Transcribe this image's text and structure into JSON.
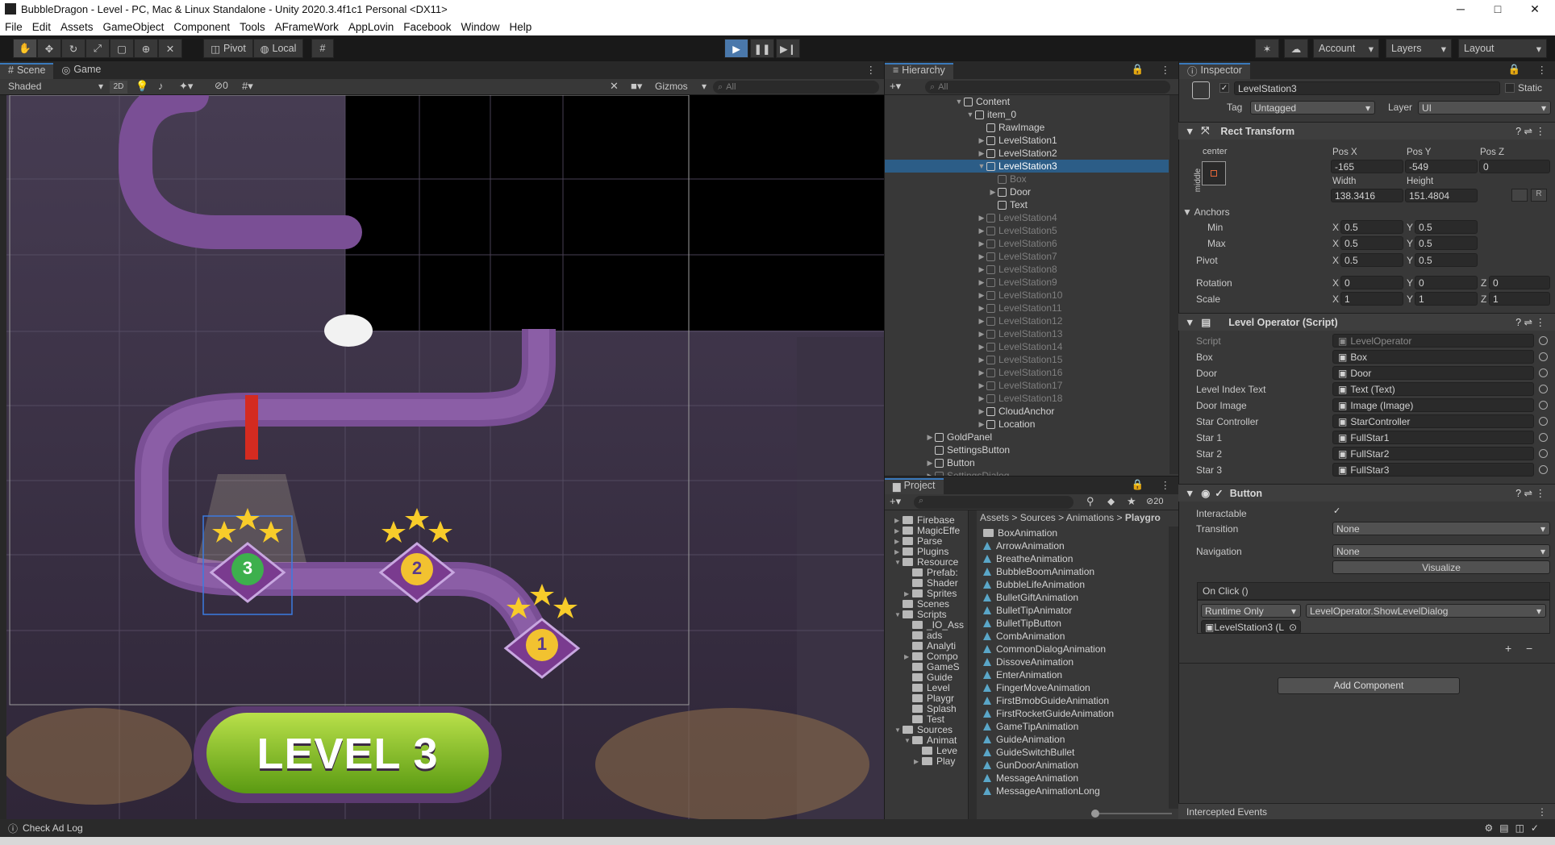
{
  "window": {
    "title": "BubbleDragon - Level - PC, Mac & Linux Standalone - Unity 2020.3.4f1c1 Personal <DX11>",
    "minimize": "─",
    "maximize": "□",
    "close": "✕"
  },
  "menu": [
    "File",
    "Edit",
    "Assets",
    "GameObject",
    "Component",
    "Tools",
    "AFrameWork",
    "AppLovin",
    "Facebook",
    "Window",
    "Help"
  ],
  "toolbar": {
    "pivot": "Pivot",
    "local": "Local",
    "account": "Account",
    "layers": "Layers",
    "layout": "Layout"
  },
  "scene": {
    "tab_scene": "Scene",
    "tab_game": "Game",
    "shading": "Shaded",
    "mode_2d": "2D",
    "hidden_count": "0",
    "gizmos": "Gizmos",
    "search_placeholder": "All",
    "level_button": "LEVEL 3",
    "station_numbers": [
      "3",
      "2",
      "1"
    ]
  },
  "hierarchy": {
    "tab": "Hierarchy",
    "search_placeholder": "All",
    "rows": [
      {
        "label": "Content",
        "indent": 0,
        "arrow": "▼",
        "dim": false,
        "sel": false
      },
      {
        "label": "item_0",
        "indent": 1,
        "arrow": "▼",
        "dim": false,
        "sel": false
      },
      {
        "label": "RawImage",
        "indent": 2,
        "arrow": "",
        "dim": false,
        "sel": false
      },
      {
        "label": "LevelStation1",
        "indent": 2,
        "arrow": "▶",
        "dim": false,
        "sel": false
      },
      {
        "label": "LevelStation2",
        "indent": 2,
        "arrow": "▶",
        "dim": false,
        "sel": false
      },
      {
        "label": "LevelStation3",
        "indent": 2,
        "arrow": "▼",
        "dim": false,
        "sel": true
      },
      {
        "label": "Box",
        "indent": 3,
        "arrow": "",
        "dim": true,
        "sel": false
      },
      {
        "label": "Door",
        "indent": 3,
        "arrow": "▶",
        "dim": false,
        "sel": false
      },
      {
        "label": "Text",
        "indent": 3,
        "arrow": "",
        "dim": false,
        "sel": false
      },
      {
        "label": "LevelStation4",
        "indent": 2,
        "arrow": "▶",
        "dim": true,
        "sel": false
      },
      {
        "label": "LevelStation5",
        "indent": 2,
        "arrow": "▶",
        "dim": true,
        "sel": false
      },
      {
        "label": "LevelStation6",
        "indent": 2,
        "arrow": "▶",
        "dim": true,
        "sel": false
      },
      {
        "label": "LevelStation7",
        "indent": 2,
        "arrow": "▶",
        "dim": true,
        "sel": false
      },
      {
        "label": "LevelStation8",
        "indent": 2,
        "arrow": "▶",
        "dim": true,
        "sel": false
      },
      {
        "label": "LevelStation9",
        "indent": 2,
        "arrow": "▶",
        "dim": true,
        "sel": false
      },
      {
        "label": "LevelStation10",
        "indent": 2,
        "arrow": "▶",
        "dim": true,
        "sel": false
      },
      {
        "label": "LevelStation11",
        "indent": 2,
        "arrow": "▶",
        "dim": true,
        "sel": false
      },
      {
        "label": "LevelStation12",
        "indent": 2,
        "arrow": "▶",
        "dim": true,
        "sel": false
      },
      {
        "label": "LevelStation13",
        "indent": 2,
        "arrow": "▶",
        "dim": true,
        "sel": false
      },
      {
        "label": "LevelStation14",
        "indent": 2,
        "arrow": "▶",
        "dim": true,
        "sel": false
      },
      {
        "label": "LevelStation15",
        "indent": 2,
        "arrow": "▶",
        "dim": true,
        "sel": false
      },
      {
        "label": "LevelStation16",
        "indent": 2,
        "arrow": "▶",
        "dim": true,
        "sel": false
      },
      {
        "label": "LevelStation17",
        "indent": 2,
        "arrow": "▶",
        "dim": true,
        "sel": false
      },
      {
        "label": "LevelStation18",
        "indent": 2,
        "arrow": "▶",
        "dim": true,
        "sel": false
      },
      {
        "label": "CloudAnchor",
        "indent": 2,
        "arrow": "▶",
        "dim": false,
        "sel": false
      },
      {
        "label": "Location",
        "indent": 2,
        "arrow": "▶",
        "dim": false,
        "sel": false
      },
      {
        "label": "GoldPanel",
        "indent": -1,
        "arrow": "▶",
        "dim": false,
        "sel": false
      },
      {
        "label": "SettingsButton",
        "indent": -1,
        "arrow": "",
        "dim": false,
        "sel": false
      },
      {
        "label": "Button",
        "indent": -1,
        "arrow": "▶",
        "dim": false,
        "sel": false
      },
      {
        "label": "SettingsDialog",
        "indent": -1,
        "arrow": "▶",
        "dim": true,
        "sel": false
      }
    ]
  },
  "project": {
    "tab": "Project",
    "count": "20",
    "breadcrumb": [
      "Assets",
      "Sources",
      "Animations",
      "Playgro"
    ],
    "tree": [
      {
        "label": "Firebase",
        "indent": 0,
        "arrow": "▶"
      },
      {
        "label": "MagicEffe",
        "indent": 0,
        "arrow": "▶"
      },
      {
        "label": "Parse",
        "indent": 0,
        "arrow": "▶"
      },
      {
        "label": "Plugins",
        "indent": 0,
        "arrow": "▶"
      },
      {
        "label": "Resource",
        "indent": 0,
        "arrow": "▼"
      },
      {
        "label": "Prefab:",
        "indent": 1,
        "arrow": ""
      },
      {
        "label": "Shader",
        "indent": 1,
        "arrow": ""
      },
      {
        "label": "Sprites",
        "indent": 1,
        "arrow": "▶"
      },
      {
        "label": "Scenes",
        "indent": 0,
        "arrow": ""
      },
      {
        "label": "Scripts",
        "indent": 0,
        "arrow": "▼"
      },
      {
        "label": "_IO_Ass",
        "indent": 1,
        "arrow": ""
      },
      {
        "label": "ads",
        "indent": 1,
        "arrow": ""
      },
      {
        "label": "Analyti",
        "indent": 1,
        "arrow": ""
      },
      {
        "label": "Compo",
        "indent": 1,
        "arrow": "▶"
      },
      {
        "label": "GameS",
        "indent": 1,
        "arrow": ""
      },
      {
        "label": "Guide",
        "indent": 1,
        "arrow": ""
      },
      {
        "label": "Level",
        "indent": 1,
        "arrow": ""
      },
      {
        "label": "Playgr",
        "indent": 1,
        "arrow": ""
      },
      {
        "label": "Splash",
        "indent": 1,
        "arrow": ""
      },
      {
        "label": "Test",
        "indent": 1,
        "arrow": ""
      },
      {
        "label": "Sources",
        "indent": 0,
        "arrow": "▼"
      },
      {
        "label": "Animat",
        "indent": 1,
        "arrow": "▼"
      },
      {
        "label": "Leve",
        "indent": 2,
        "arrow": ""
      },
      {
        "label": "Play",
        "indent": 2,
        "arrow": "▶"
      }
    ],
    "files": [
      {
        "label": "BoxAnimation",
        "folder": true
      },
      {
        "label": "ArrowAnimation",
        "folder": false
      },
      {
        "label": "BreatheAnimation",
        "folder": false
      },
      {
        "label": "BubbleBoomAnimation",
        "folder": false
      },
      {
        "label": "BubbleLifeAnimation",
        "folder": false
      },
      {
        "label": "BulletGiftAnimation",
        "folder": false
      },
      {
        "label": "BulletTipAnimator",
        "folder": false
      },
      {
        "label": "BulletTipButton",
        "folder": false
      },
      {
        "label": "CombAnimation",
        "folder": false
      },
      {
        "label": "CommonDialogAnimation",
        "folder": false
      },
      {
        "label": "DissoveAnimation",
        "folder": false
      },
      {
        "label": "EnterAnimation",
        "folder": false
      },
      {
        "label": "FingerMoveAnimation",
        "folder": false
      },
      {
        "label": "FirstBmobGuideAnimation",
        "folder": false
      },
      {
        "label": "FirstRocketGuideAnimation",
        "folder": false
      },
      {
        "label": "GameTipAnimation",
        "folder": false
      },
      {
        "label": "GuideAnimation",
        "folder": false
      },
      {
        "label": "GuideSwitchBullet",
        "folder": false
      },
      {
        "label": "GunDoorAnimation",
        "folder": false
      },
      {
        "label": "MessageAnimation",
        "folder": false
      },
      {
        "label": "MessageAnimationLong",
        "folder": false
      }
    ]
  },
  "inspector": {
    "tab": "Inspector",
    "object_name": "LevelStation3",
    "static": "Static",
    "tag_label": "Tag",
    "tag_value": "Untagged",
    "layer_label": "Layer",
    "layer_value": "UI",
    "rect": {
      "title": "Rect Transform",
      "anchor_preset_h": "center",
      "anchor_preset_v": "middle",
      "posx_label": "Pos X",
      "posy_label": "Pos Y",
      "posz_label": "Pos Z",
      "posx": "-165",
      "posy": "-549",
      "posz": "0",
      "width_label": "Width",
      "height_label": "Height",
      "width": "138.3416",
      "height": "151.4804",
      "r_button": "R",
      "anchors": "Anchors",
      "min": "Min",
      "max": "Max",
      "min_x": "0.5",
      "min_y": "0.5",
      "max_x": "0.5",
      "max_y": "0.5",
      "pivot": "Pivot",
      "pivot_x": "0.5",
      "pivot_y": "0.5",
      "rotation": "Rotation",
      "rot_x": "0",
      "rot_y": "0",
      "rot_z": "0",
      "scale": "Scale",
      "sc_x": "1",
      "sc_y": "1",
      "sc_z": "1",
      "x": "X",
      "y": "Y",
      "z": "Z"
    },
    "script": {
      "title": "Level Operator (Script)",
      "fields": [
        {
          "label": "Script",
          "value": "LevelOperator",
          "dim": true
        },
        {
          "label": "Box",
          "value": "Box",
          "dim": false
        },
        {
          "label": "Door",
          "value": "Door",
          "dim": false
        },
        {
          "label": "Level Index Text",
          "value": "Text (Text)",
          "dim": false
        },
        {
          "label": "Door Image",
          "value": "Image (Image)",
          "dim": false
        },
        {
          "label": "Star Controller",
          "value": "StarController",
          "dim": false
        },
        {
          "label": "Star 1",
          "value": "FullStar1",
          "dim": false
        },
        {
          "label": "Star 2",
          "value": "FullStar2",
          "dim": false
        },
        {
          "label": "Star 3",
          "value": "FullStar3",
          "dim": false
        }
      ]
    },
    "button": {
      "title": "Button",
      "interactable": "Interactable",
      "transition": "Transition",
      "transition_value": "None",
      "navigation": "Navigation",
      "navigation_value": "None",
      "visualize": "Visualize",
      "onclick": "On Click ()",
      "runtime": "Runtime Only",
      "function": "LevelOperator.ShowLevelDialog",
      "target": "LevelStation3 (L",
      "plus": "+",
      "minus": "−"
    },
    "add_component": "Add Component",
    "intercepted": "Intercepted Events"
  },
  "status": {
    "text": "Check Ad Log"
  }
}
